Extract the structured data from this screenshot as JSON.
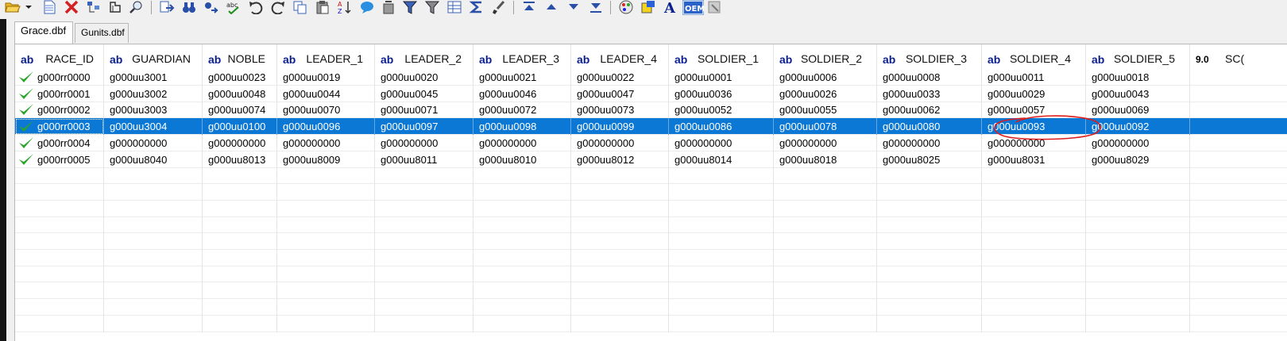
{
  "toolbar": {
    "icons": [
      "open-folder-icon",
      "dropdown-arrow-icon",
      "new-file-icon",
      "delete-icon",
      "structure-icon",
      "fields-icon",
      "find-icon",
      "export-icon",
      "search-binoculars-icon",
      "replace-icon",
      "spell-icon",
      "undo-icon",
      "redo-icon",
      "copy-icon",
      "paste-icon",
      "sort-icon",
      "comment-icon",
      "filter-icon",
      "filter-clear-icon",
      "funnel-icon",
      "table-icon",
      "sum-icon",
      "brush-icon",
      "first-record-icon",
      "prev-record-icon",
      "next-record-icon",
      "last-record-icon",
      "colors-icon",
      "highlight-icon",
      "font-icon",
      "oem-icon",
      "settings-icon"
    ],
    "oem_label": "OEM",
    "font_glyph": "A"
  },
  "tabs": [
    {
      "label": "Grace.dbf",
      "active": true
    },
    {
      "label": "Gunits.dbf",
      "active": false
    }
  ],
  "grid": {
    "columns": [
      {
        "type": "ab",
        "name": "RACE_ID"
      },
      {
        "type": "ab",
        "name": "GUARDIAN"
      },
      {
        "type": "ab",
        "name": "NOBLE"
      },
      {
        "type": "ab",
        "name": "LEADER_1"
      },
      {
        "type": "ab",
        "name": "LEADER_2"
      },
      {
        "type": "ab",
        "name": "LEADER_3"
      },
      {
        "type": "ab",
        "name": "LEADER_4"
      },
      {
        "type": "ab",
        "name": "SOLDIER_1"
      },
      {
        "type": "ab",
        "name": "SOLDIER_2"
      },
      {
        "type": "ab",
        "name": "SOLDIER_3"
      },
      {
        "type": "ab",
        "name": "SOLDIER_4"
      },
      {
        "type": "ab",
        "name": "SOLDIER_5"
      },
      {
        "type": "9.0",
        "name": "SC("
      }
    ],
    "rows": [
      {
        "selected": false,
        "cells": [
          "g000rr0000",
          "g000uu3001",
          "g000uu0023",
          "g000uu0019",
          "g000uu0020",
          "g000uu0021",
          "g000uu0022",
          "g000uu0001",
          "g000uu0006",
          "g000uu0008",
          "g000uu0011",
          "g000uu0018",
          ""
        ]
      },
      {
        "selected": false,
        "cells": [
          "g000rr0001",
          "g000uu3002",
          "g000uu0048",
          "g000uu0044",
          "g000uu0045",
          "g000uu0046",
          "g000uu0047",
          "g000uu0036",
          "g000uu0026",
          "g000uu0033",
          "g000uu0029",
          "g000uu0043",
          ""
        ]
      },
      {
        "selected": false,
        "cells": [
          "g000rr0002",
          "g000uu3003",
          "g000uu0074",
          "g000uu0070",
          "g000uu0071",
          "g000uu0072",
          "g000uu0073",
          "g000uu0052",
          "g000uu0055",
          "g000uu0062",
          "g000uu0057",
          "g000uu0069",
          ""
        ]
      },
      {
        "selected": true,
        "cells": [
          "g000rr0003",
          "g000uu3004",
          "g000uu0100",
          "g000uu0096",
          "g000uu0097",
          "g000uu0098",
          "g000uu0099",
          "g000uu0086",
          "g000uu0078",
          "g000uu0080",
          "g000uu0093",
          "g000uu0092",
          ""
        ]
      },
      {
        "selected": false,
        "cells": [
          "g000rr0004",
          "g000000000",
          "g000000000",
          "g000000000",
          "g000000000",
          "g000000000",
          "g000000000",
          "g000000000",
          "g000000000",
          "g000000000",
          "g000000000",
          "g000000000",
          ""
        ]
      },
      {
        "selected": false,
        "cells": [
          "g000rr0005",
          "g000uu8040",
          "g000uu8013",
          "g000uu8009",
          "g000uu8011",
          "g000uu8010",
          "g000uu8012",
          "g000uu8014",
          "g000uu8018",
          "g000uu8025",
          "g000uu8031",
          "g000uu8029",
          ""
        ]
      }
    ],
    "empty_rows": 10
  },
  "colors": {
    "selection": "#0c78d6",
    "check": "#2aa52a",
    "annotation": "#e01b1b",
    "type_badge": "#0c1f8f"
  }
}
